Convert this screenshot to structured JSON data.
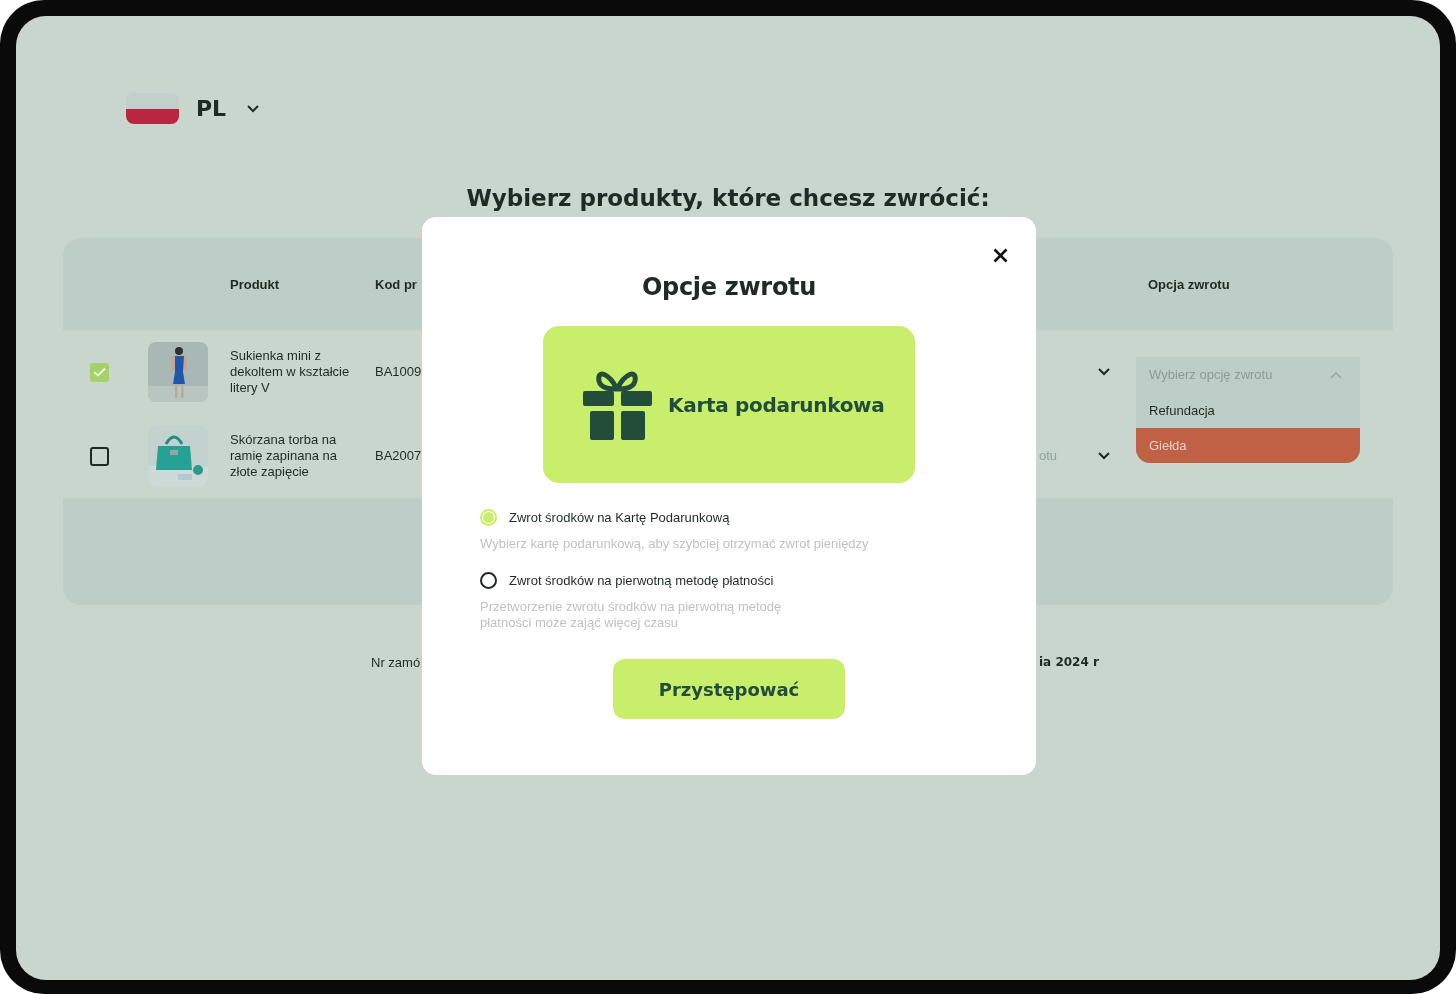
{
  "language": {
    "code": "PL"
  },
  "page_title": "Wybierz produkty, które chcesz zwrócić:",
  "table": {
    "columns": [
      "Produkt",
      "Kod pr",
      "Opcja zwrotu"
    ],
    "rows": [
      {
        "checked": true,
        "name": "Sukienka mini z dekoltem w kształcie litery V",
        "code": "BA1009",
        "return_option": {
          "placeholder": "Wybierz opcję zwrotu",
          "expanded": true,
          "options": [
            {
              "label": "Refundacja",
              "selected": false
            },
            {
              "label": "Giełda",
              "selected": true
            }
          ]
        }
      },
      {
        "checked": false,
        "name": "Skórzana torba na ramię zapinana na złote zapięcie",
        "code": "BA2007",
        "column_3": "otu"
      }
    ]
  },
  "footer": [
    "Nr zamó",
    "ia 2024 r"
  ],
  "modal": {
    "title": "Opcje zwrotu",
    "card_label": "Karta podarunkowa",
    "options": [
      {
        "label": "Zwrot środków na Kartę Podarunkową",
        "description": "Wybierz kartę podarunkową, aby szybciej otrzymać zwrot pieniędzy",
        "selected": true
      },
      {
        "label": "Zwrot środków na pierwotną metodę płatności",
        "description": "Przetworzenie zwrotu środków na pierwotną metodę płatności może zająć więcej czasu",
        "selected": false
      }
    ],
    "button": "Przystępować"
  }
}
